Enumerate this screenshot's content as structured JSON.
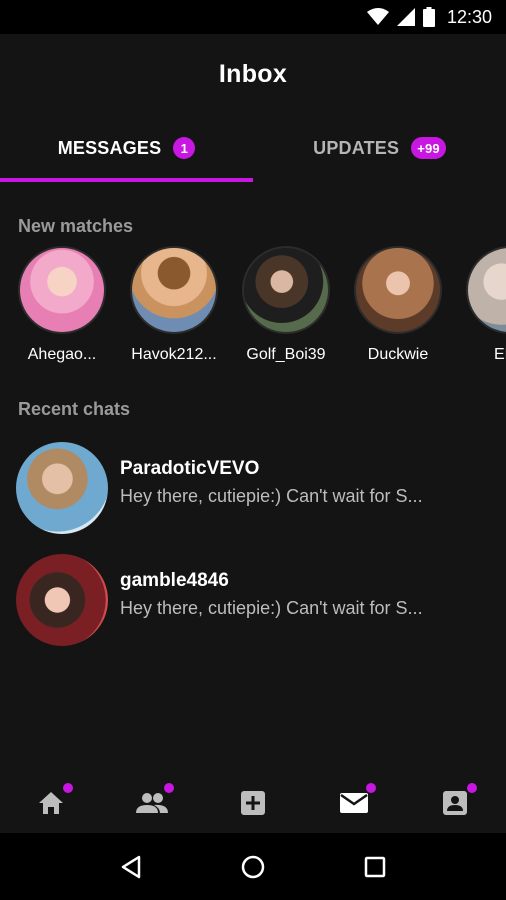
{
  "status_bar": {
    "time": "12:30",
    "icons": [
      "wifi-icon",
      "cellular-icon",
      "battery-icon"
    ]
  },
  "header": {
    "title": "Inbox"
  },
  "tabs": [
    {
      "label": "MESSAGES",
      "badge": "1",
      "active": true
    },
    {
      "label": "UPDATES",
      "badge": "+99",
      "active": false
    }
  ],
  "new_matches": {
    "label": "New matches",
    "items": [
      {
        "name": "Ahegao..."
      },
      {
        "name": "Havok212..."
      },
      {
        "name": "Golf_Boi39"
      },
      {
        "name": "Duckwie"
      },
      {
        "name": "ENT"
      }
    ]
  },
  "recent_chats": {
    "label": "Recent chats",
    "items": [
      {
        "name": "ParadoticVEVO",
        "message": "Hey there, cutiepie:) Can't wait for S..."
      },
      {
        "name": "gamble4846",
        "message": "Hey there, cutiepie:) Can't wait for S..."
      }
    ]
  },
  "bottom_nav": {
    "items": [
      {
        "icon": "home-icon",
        "has_notification": true
      },
      {
        "icon": "people-icon",
        "has_notification": true
      },
      {
        "icon": "add-box-icon",
        "has_notification": false
      },
      {
        "icon": "mail-icon",
        "has_notification": true,
        "active": true
      },
      {
        "icon": "profile-card-icon",
        "has_notification": true
      }
    ]
  },
  "colors": {
    "accent": "#c817e0",
    "background": "#141414",
    "secondary_text": "#9a9a9a"
  }
}
